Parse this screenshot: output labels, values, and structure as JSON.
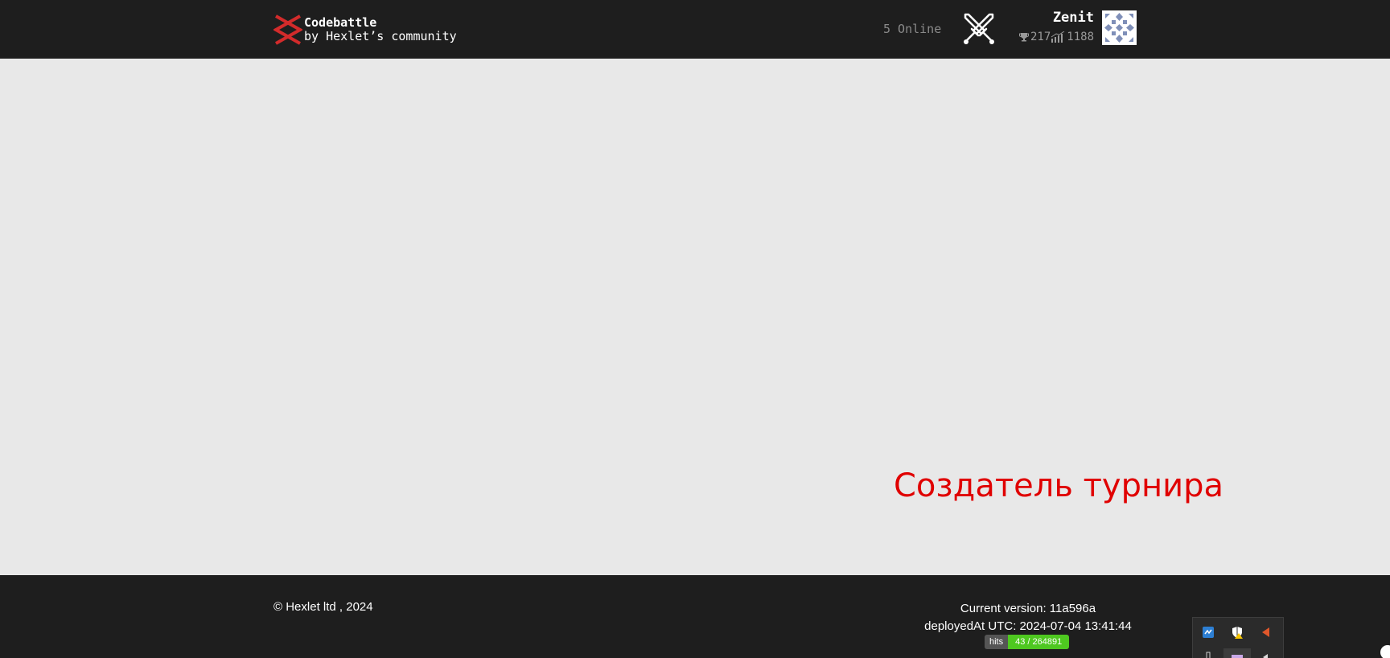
{
  "header": {
    "logo": {
      "title": "Codebattle",
      "subtitle": "by Hexlet’s community",
      "icon": "codebattle-logo-icon",
      "color": "#d32b2b"
    },
    "online_text": "5 Online",
    "battle_icon": "crossed-swords-icon",
    "user": {
      "name": "Zenit",
      "rank_icon": "trophy-icon",
      "rank": "217",
      "rating_icon": "chart-icon",
      "rating": "1188",
      "avatar_icon": "identicon-avatar"
    }
  },
  "main": {
    "caption": "Создатель турнира",
    "caption_color": "#e00000"
  },
  "footer": {
    "copyright": "© Hexlet ltd , 2024",
    "version": "Current version: 11a596a",
    "deployed": "deployedAt UTC: 2024-07-04 13:41:44",
    "hits_label": "hits",
    "hits_value": "43 / 264891",
    "hits_color": "#4ec820"
  },
  "tray": {
    "icons": [
      "network-icon",
      "security-warning-icon",
      "speaker-icon",
      "usb-icon",
      "app-icon",
      "volume-icon"
    ]
  }
}
